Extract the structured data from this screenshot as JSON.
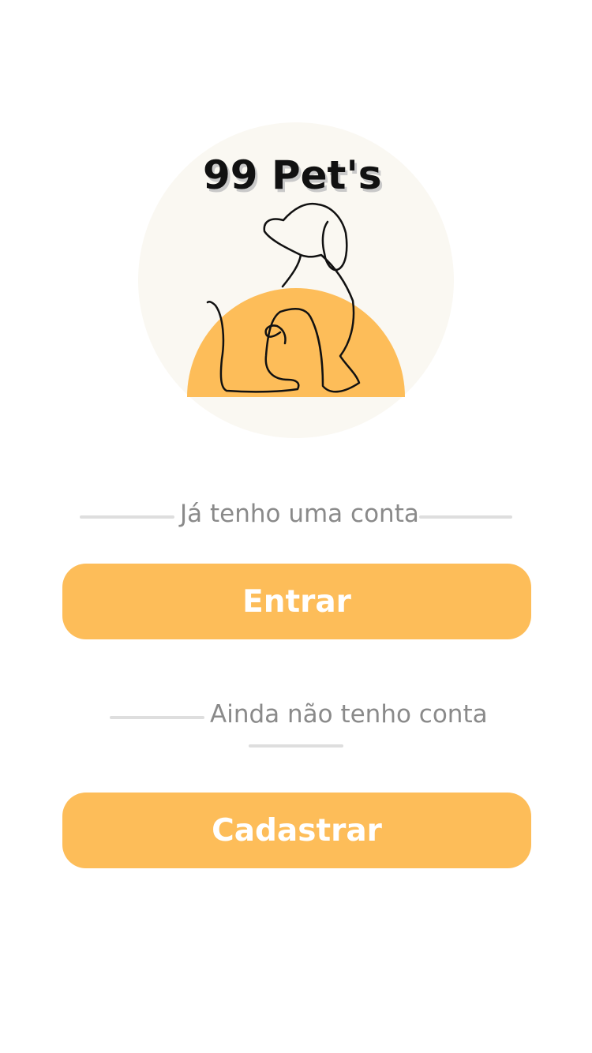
{
  "logo": {
    "text": "99 Pet's",
    "background_color": "#faf8f2",
    "sun_color": "#fdbd59",
    "line_color": "#111111"
  },
  "login_section": {
    "label": "Já tenho uma conta",
    "button_label": "Entrar"
  },
  "signup_section": {
    "label": "Ainda não tenho conta",
    "button_label": "Cadastrar"
  },
  "colors": {
    "accent": "#fdbd59",
    "separator": "#dedede",
    "label_text": "#8a8a8a",
    "button_text": "#ffffff"
  }
}
